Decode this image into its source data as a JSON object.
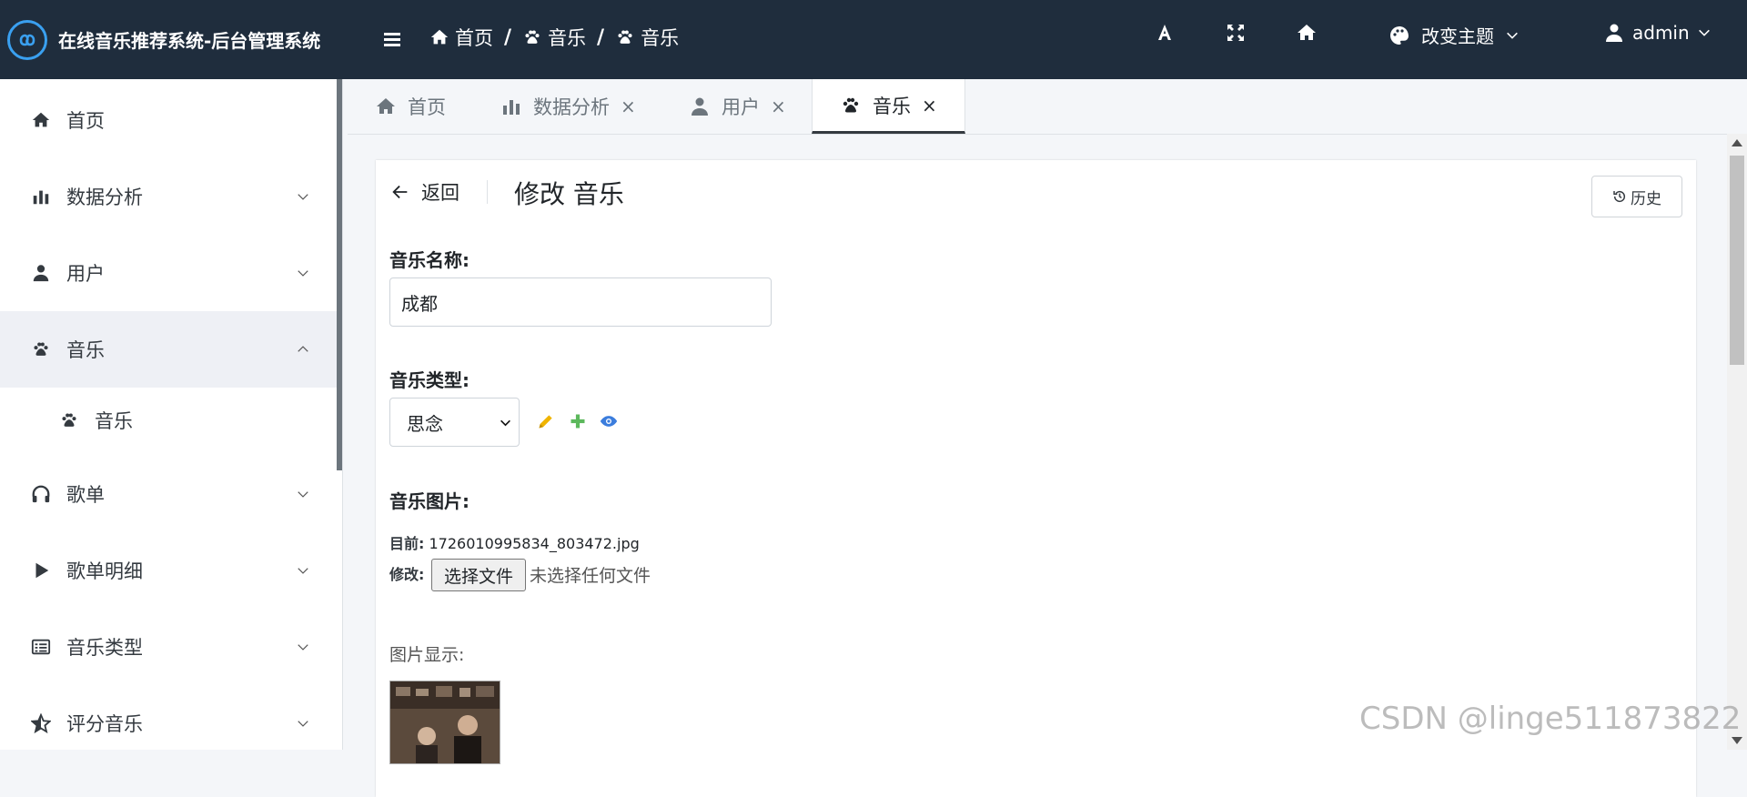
{
  "brand": {
    "title": "在线音乐推荐系统-后台管理系统"
  },
  "breadcrumb": [
    {
      "label": "首页",
      "icon": "home-icon"
    },
    {
      "label": "音乐",
      "icon": "paw-icon"
    },
    {
      "label": "音乐",
      "icon": "paw-icon"
    }
  ],
  "breadcrumb_sep": "/",
  "navbar": {
    "theme_label": "改变主题",
    "user_label": "admin"
  },
  "sidebar": {
    "items": [
      {
        "label": "首页",
        "icon": "home-icon"
      },
      {
        "label": "数据分析",
        "icon": "bar-chart-icon"
      },
      {
        "label": "用户",
        "icon": "user-icon"
      },
      {
        "label": "音乐",
        "icon": "paw-icon"
      },
      {
        "label": "音乐",
        "icon": "paw-icon"
      },
      {
        "label": "歌单",
        "icon": "headphones-icon"
      },
      {
        "label": "歌单明细",
        "icon": "play-icon"
      },
      {
        "label": "音乐类型",
        "icon": "table-list-icon"
      },
      {
        "label": "评分音乐",
        "icon": "star-half-icon"
      }
    ]
  },
  "tabs": [
    {
      "label": "首页",
      "icon": "home-icon"
    },
    {
      "label": "数据分析",
      "icon": "bar-chart-icon",
      "close": "×"
    },
    {
      "label": "用户",
      "icon": "user-icon",
      "close": "×"
    },
    {
      "label": "音乐",
      "icon": "paw-icon",
      "close": "×"
    }
  ],
  "form": {
    "back_label": "返回",
    "title": "修改 音乐",
    "history_label": "历史",
    "name_label": "音乐名称:",
    "name_value": "成都",
    "type_label": "音乐类型:",
    "type_value": "思念",
    "image_label": "音乐图片:",
    "current_prefix": "目前:",
    "current_file": "1726010995834_803472.jpg",
    "modify_prefix": "修改:",
    "choose_file_button": "选择文件",
    "no_file_text": "未选择任何文件",
    "preview_label": "图片显示:"
  },
  "watermark": "CSDN @linge511873822",
  "colors": {
    "navbar_bg": "#1f2d3d",
    "edit_icon": "#f0b400",
    "add_icon": "#5cb85c",
    "view_icon": "#3b7ddd"
  }
}
